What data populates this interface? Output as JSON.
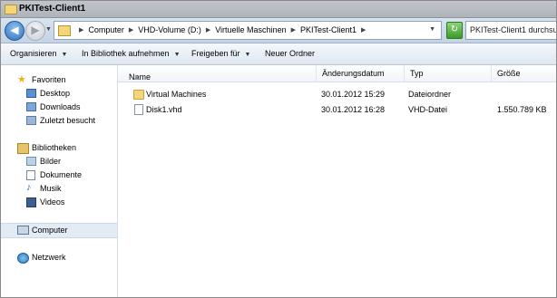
{
  "window": {
    "title": "PKITest-Client1"
  },
  "address": {
    "crumbs": [
      "Computer",
      "VHD-Volume (D:)",
      "Virtuelle Maschinen",
      "PKITest-Client1"
    ],
    "search_placeholder": "PKITest-Client1 durchsu"
  },
  "toolbar": {
    "organize": "Organisieren",
    "include_library": "In Bibliothek aufnehmen",
    "share_with": "Freigeben für",
    "new_folder": "Neuer Ordner"
  },
  "sidebar": {
    "favorites": {
      "label": "Favoriten",
      "items": [
        "Desktop",
        "Downloads",
        "Zuletzt besucht"
      ]
    },
    "libraries": {
      "label": "Bibliotheken",
      "items": [
        "Bilder",
        "Dokumente",
        "Musik",
        "Videos"
      ]
    },
    "computer": "Computer",
    "network": "Netzwerk"
  },
  "columns": [
    "Name",
    "Änderungsdatum",
    "Typ",
    "Größe"
  ],
  "files": [
    {
      "name": "Virtual Machines",
      "date": "30.01.2012 15:29",
      "type": "Dateiordner",
      "size": "",
      "icon": "folder-icon"
    },
    {
      "name": "Disk1.vhd",
      "date": "30.01.2012 16:28",
      "type": "VHD-Datei",
      "size": "1.550.789 KB",
      "icon": "file-icon"
    }
  ]
}
